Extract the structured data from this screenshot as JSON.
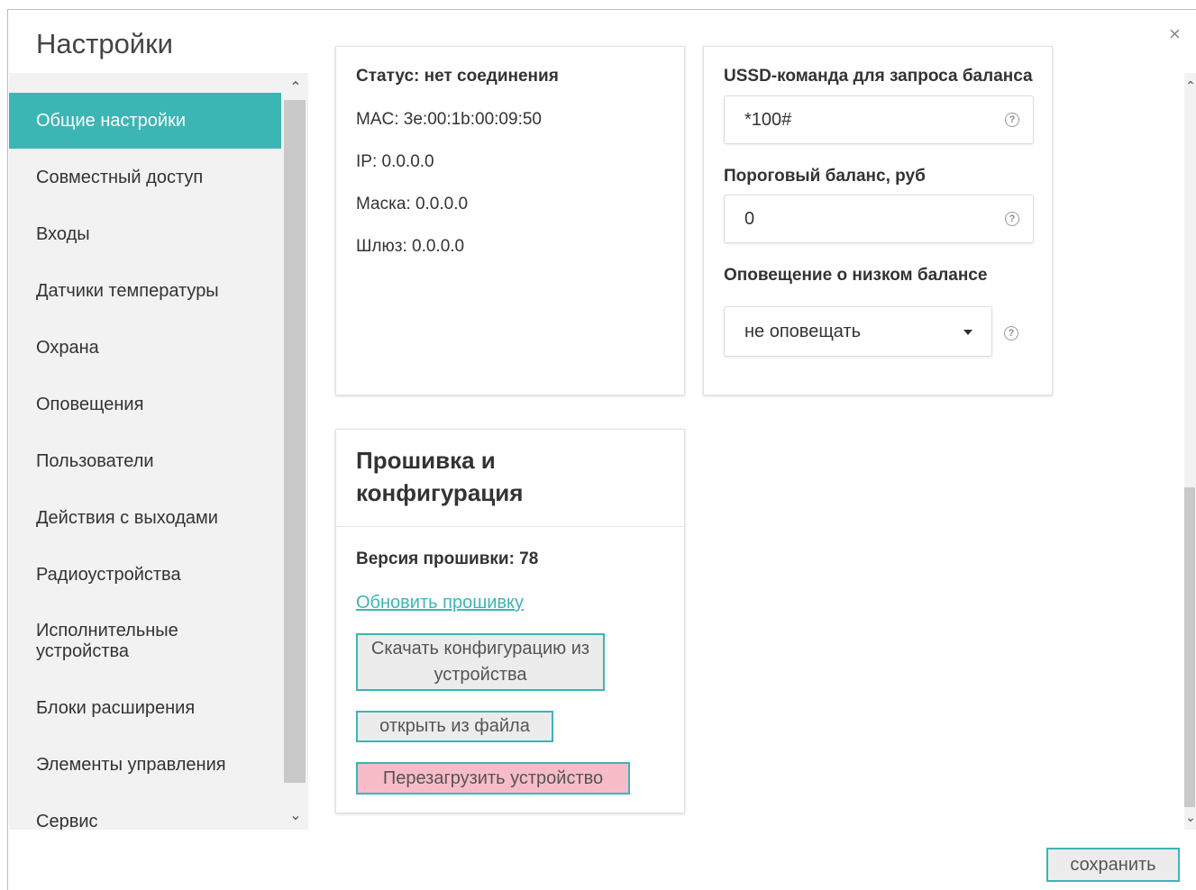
{
  "dialog": {
    "title": "Настройки",
    "close_label": "×"
  },
  "sidebar": {
    "items": [
      {
        "label": "Общие настройки",
        "active": true
      },
      {
        "label": "Совместный доступ"
      },
      {
        "label": "Входы"
      },
      {
        "label": "Датчики температуры"
      },
      {
        "label": "Охрана"
      },
      {
        "label": "Оповещения"
      },
      {
        "label": "Пользователи"
      },
      {
        "label": "Действия с выходами"
      },
      {
        "label": "Радиоустройства"
      },
      {
        "label": "Исполнительные устройства"
      },
      {
        "label": "Блоки расширения"
      },
      {
        "label": "Элементы управления"
      },
      {
        "label": "Сервис"
      }
    ],
    "scroll_up": "⌃",
    "scroll_down": "⌄"
  },
  "network": {
    "status": "Статус: нет соединения",
    "mac": "MAC: 3e:00:1b:00:09:50",
    "ip": "IP: 0.0.0.0",
    "mask": "Маска: 0.0.0.0",
    "gateway": "Шлюз: 0.0.0.0"
  },
  "gsm": {
    "ussd_label": "USSD-команда для запроса баланса",
    "ussd_value": "*100#",
    "threshold_label": "Пороговый баланс, руб",
    "threshold_value": "0",
    "low_balance_label": "Оповещение о низком балансе",
    "low_balance_value": "не оповещать",
    "help_glyph": "?"
  },
  "firmware": {
    "title": "Прошивка и конфигурация",
    "version": "Версия прошивки: 78",
    "update_link": "Обновить прошивку",
    "download_btn": "Скачать конфигурацию из устройства",
    "open_btn": "открыть из файла",
    "reboot_btn": "Перезагрузить устройство"
  },
  "footer": {
    "save_label": "сохранить"
  },
  "colors": {
    "accent": "#3cb5b5",
    "danger": "#f8bcc9",
    "sidebar_bg": "#f2f2f2"
  }
}
